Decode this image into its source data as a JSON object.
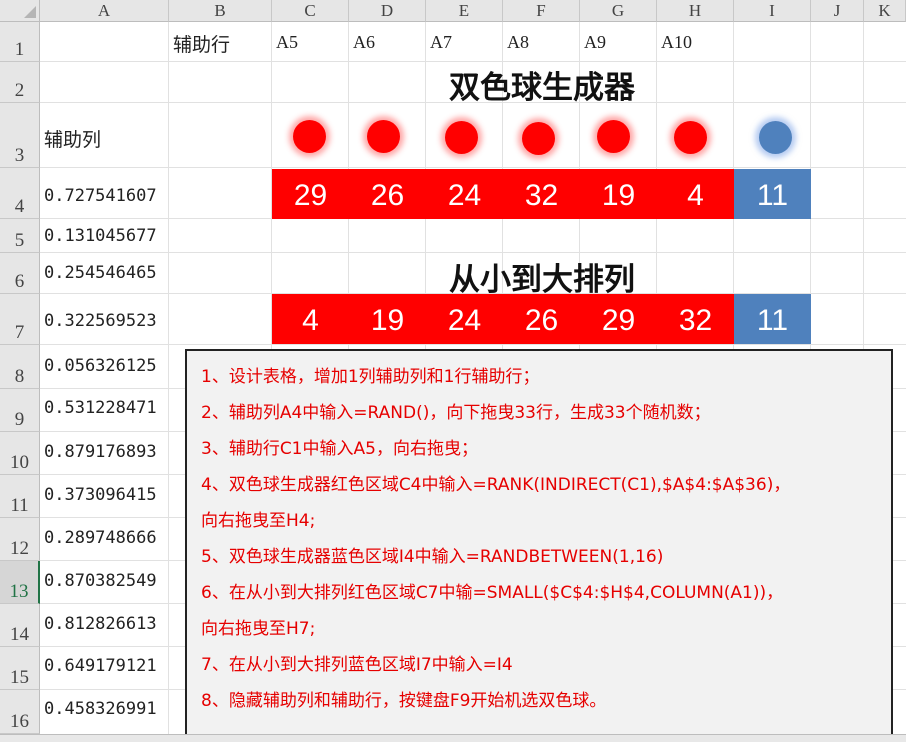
{
  "columns": [
    "A",
    "B",
    "C",
    "D",
    "E",
    "F",
    "G",
    "H",
    "I",
    "J",
    "K"
  ],
  "rows": [
    "1",
    "2",
    "3",
    "4",
    "5",
    "6",
    "7",
    "8",
    "9",
    "10",
    "11",
    "12",
    "13",
    "14",
    "15",
    "16"
  ],
  "active_row": "13",
  "row1": {
    "helper_row_label": "辅助行",
    "refs": [
      "A5",
      "A6",
      "A7",
      "A8",
      "A9",
      "A10"
    ]
  },
  "helper_col_label": "辅助列",
  "rand_values": [
    "0.727541607",
    "0.131045677",
    "0.254546465",
    "0.322569523",
    "0.056326125",
    "0.531228471",
    "0.879176893",
    "0.373096415",
    "0.289748666",
    "0.870382549",
    "0.812826613",
    "0.649179121",
    "0.458326991"
  ],
  "generator": {
    "title": "双色球生成器",
    "red_numbers": [
      "29",
      "26",
      "24",
      "32",
      "19",
      "4"
    ],
    "blue_number": "11"
  },
  "sorted": {
    "title": "从小到大排列",
    "red_numbers": [
      "4",
      "19",
      "24",
      "26",
      "29",
      "32"
    ],
    "blue_number": "11"
  },
  "instructions": [
    "1、设计表格，增加1列辅助列和1行辅助行；",
    "2、辅助列A4中输入=RAND()，向下拖曳33行，生成33个随机数；",
    "3、辅助行C1中输入A5，向右拖曳；",
    "4、双色球生成器红色区域C4中输入=RANK(INDIRECT(C1),$A$4:$A$36)，",
    "向右拖曳至H4;",
    "5、双色球生成器蓝色区域I4中输入=RANDBETWEEN(1,16)",
    "6、在从小到大排列红色区域C7中输=SMALL($C$4:$H$4,COLUMN(A1))，",
    "向右拖曳至H7;",
    "7、在从小到大排列蓝色区域I7中输入=I4",
    "8、隐藏辅助列和辅助行，按键盘F9开始机选双色球。"
  ],
  "colors": {
    "red": "#ff0000",
    "blue": "#4f81bd",
    "instruction_text": "#e60000"
  }
}
